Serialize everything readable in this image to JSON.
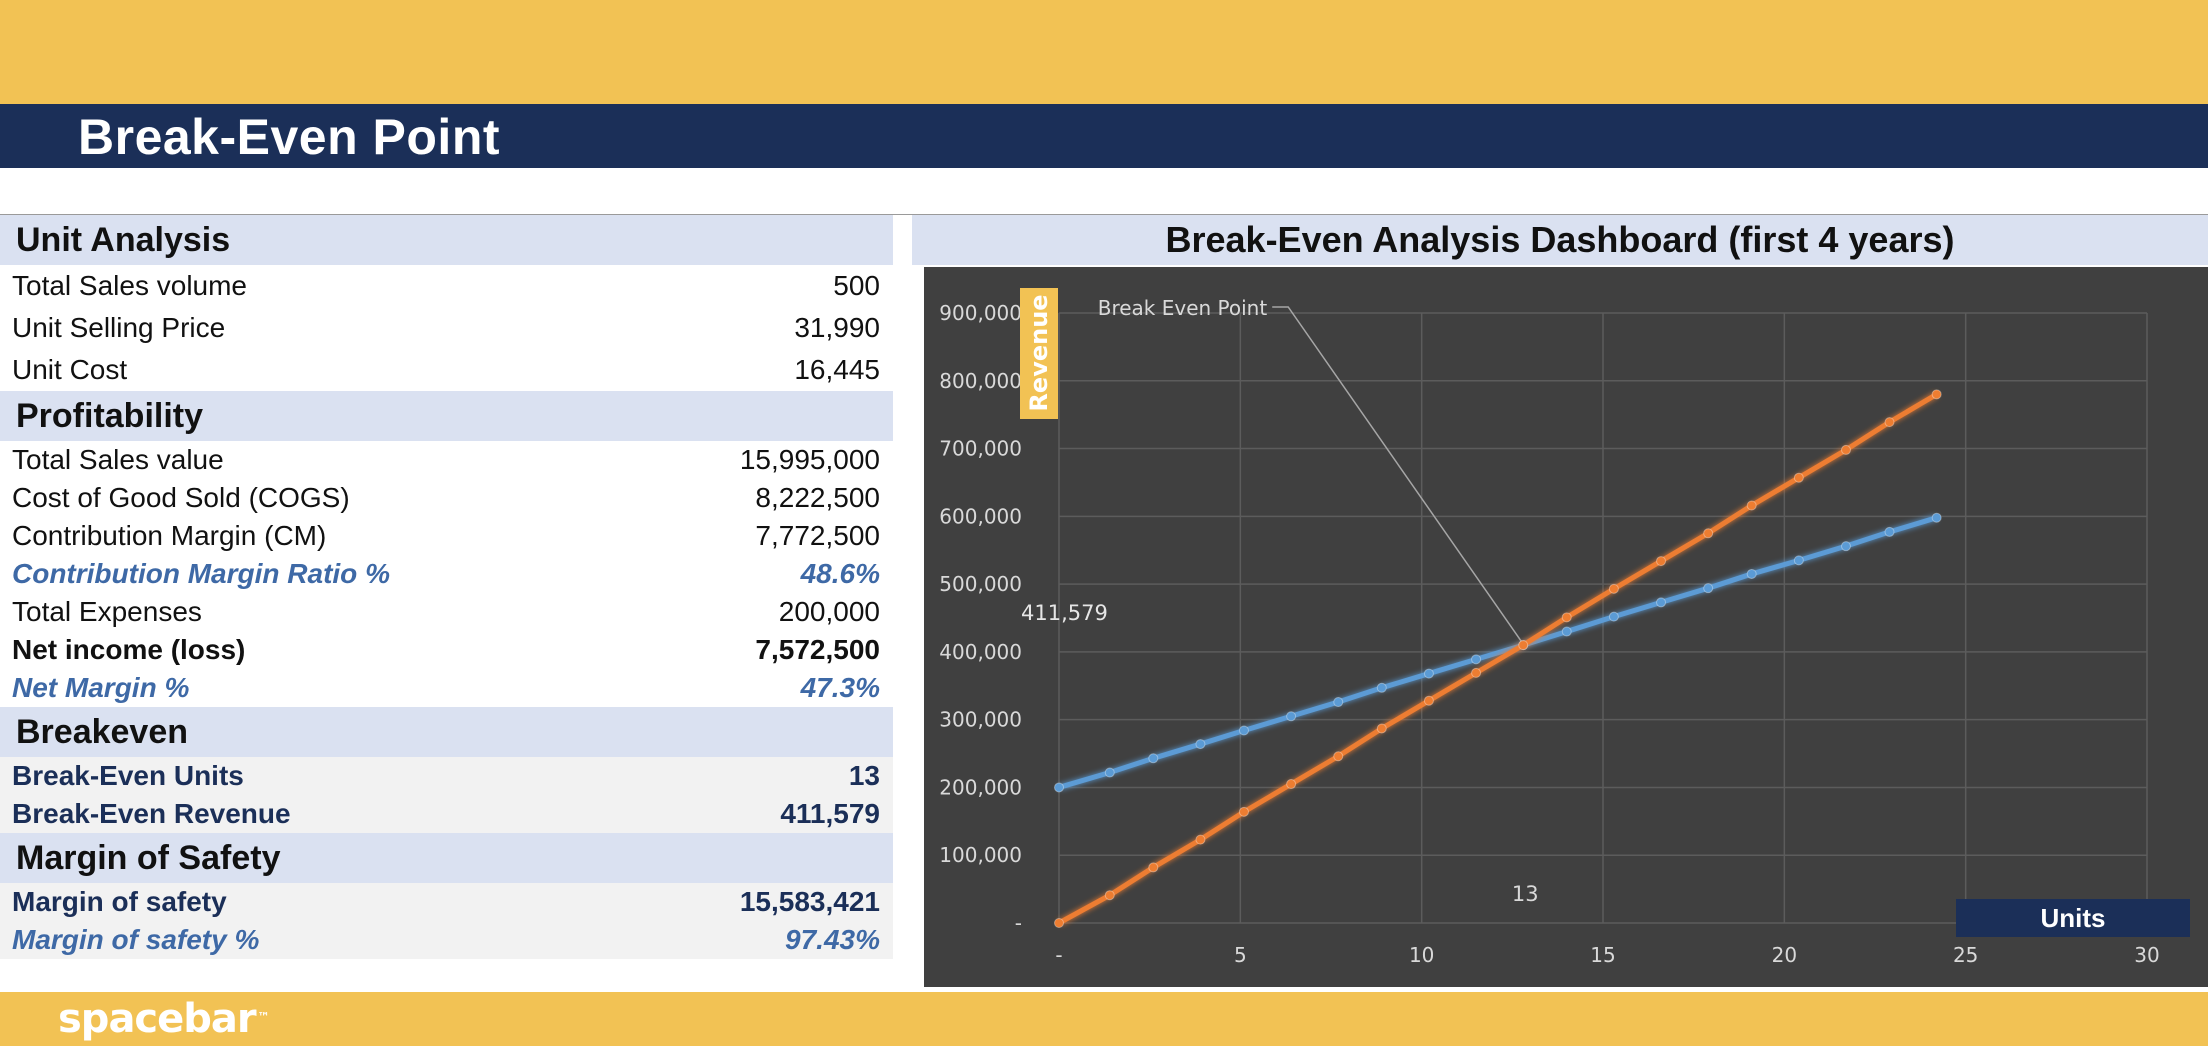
{
  "header": {
    "title": "Break-Even Point"
  },
  "unit_analysis": {
    "title": "Unit Analysis",
    "rows": [
      {
        "label": "Total Sales volume",
        "value": "500"
      },
      {
        "label": "Unit Selling Price",
        "value": "31,990"
      },
      {
        "label": "Unit Cost",
        "value": "16,445"
      }
    ]
  },
  "profitability": {
    "title": "Profitability",
    "rows": [
      {
        "label": "Total Sales value",
        "value": "15,995,000"
      },
      {
        "label": "Cost of Good Sold (COGS)",
        "value": "8,222,500"
      },
      {
        "label": "Contribution Margin (CM)",
        "value": "7,772,500"
      },
      {
        "label": "Contribution Margin Ratio %",
        "value": "48.6%"
      },
      {
        "label": "Total Expenses",
        "value": "200,000"
      },
      {
        "label": "Net income (loss)",
        "value": "7,572,500"
      },
      {
        "label": "Net Margin %",
        "value": "47.3%"
      }
    ]
  },
  "breakeven": {
    "title": "Breakeven",
    "rows": [
      {
        "label": "Break-Even Units",
        "value": "13"
      },
      {
        "label": "Break-Even Revenue",
        "value": "411,579"
      }
    ]
  },
  "margin_of_safety": {
    "title": "Margin of Safety",
    "rows": [
      {
        "label": "Margin of safety",
        "value": "15,583,421"
      },
      {
        "label": "Margin of safety %",
        "value": "97.43%"
      }
    ]
  },
  "footer": {
    "logo_text": "spacebar",
    "logo_mark": "™"
  },
  "colors": {
    "accent_yellow": "#F2C254",
    "navy": "#1B2F58",
    "section_bg": "#DAE1F1",
    "emphasis_blue": "#3E69A6",
    "plot_bg": "#404040",
    "series_cost": "#5B9BD5",
    "series_revenue": "#ED7D31"
  },
  "chart_data": {
    "type": "line",
    "title": "Break-Even Analysis Dashboard (first 4 years)",
    "xlabel": "Units",
    "ylabel": "Revenue",
    "xlim": [
      0,
      30
    ],
    "ylim": [
      0,
      900000
    ],
    "x_ticks": [
      0,
      5,
      10,
      15,
      20,
      25,
      30
    ],
    "x_tick_labels": [
      "-",
      "5",
      "10",
      "15",
      "20",
      "25",
      "30"
    ],
    "y_ticks": [
      0,
      100000,
      200000,
      300000,
      400000,
      500000,
      600000,
      700000,
      800000,
      900000
    ],
    "y_tick_labels": [
      "-",
      "100,000",
      "200,000",
      "300,000",
      "400,000",
      "500,000",
      "600,000",
      "700,000",
      "800,000",
      "900,000"
    ],
    "grid": true,
    "series": [
      {
        "x": [
          0,
          1.4,
          2.6,
          3.9,
          5.1,
          6.4,
          7.7,
          8.9,
          10.2,
          11.5,
          12.8,
          14.0,
          15.3,
          16.6,
          17.9,
          19.1,
          20.4,
          21.7,
          22.9,
          24.2
        ],
        "values": [
          200000,
          222000,
          243000,
          264000,
          284000,
          305000,
          326000,
          347000,
          368000,
          389000,
          410000,
          430000,
          452000,
          473000,
          494000,
          515000,
          535000,
          556000,
          577000,
          598000
        ]
      },
      {
        "x": [
          0,
          1.4,
          2.6,
          3.9,
          5.1,
          6.4,
          7.7,
          8.9,
          10.2,
          11.5,
          12.8,
          14.0,
          15.3,
          16.6,
          17.9,
          19.1,
          20.4,
          21.7,
          22.9,
          24.2
        ],
        "values": [
          0,
          41000,
          82000,
          123000,
          164000,
          205000,
          246000,
          287000,
          328000,
          369000,
          410000,
          451000,
          493000,
          534000,
          575000,
          616000,
          657000,
          698000,
          739000,
          780000
        ]
      }
    ],
    "break_even": {
      "x": 12.8,
      "y": 411579,
      "x_label": "13",
      "y_label": "411,579",
      "annotation": "Break Even Point"
    }
  }
}
